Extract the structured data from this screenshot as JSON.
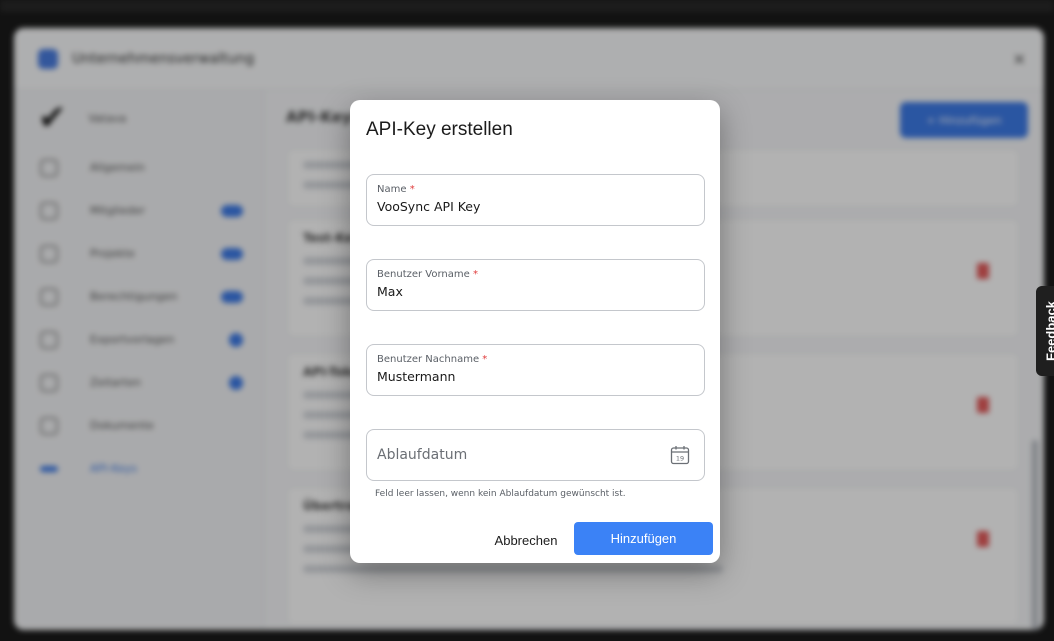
{
  "background": {
    "app_title": "Unternehmensverwaltung",
    "sidebar_header": "Vatava",
    "sidebar_items": [
      {
        "label": "Allgemein",
        "indicator": "none"
      },
      {
        "label": "Mitglieder",
        "indicator": "badge"
      },
      {
        "label": "Projekte",
        "indicator": "badge"
      },
      {
        "label": "Berechtigungen",
        "indicator": "badge"
      },
      {
        "label": "Exportvorlagen",
        "indicator": "dot"
      },
      {
        "label": "Zeitarten",
        "indicator": "dot"
      },
      {
        "label": "Dokumente",
        "indicator": "none"
      },
      {
        "label": "API-Keys",
        "indicator": "active"
      }
    ],
    "content_title": "API-Keys",
    "add_button_label": "+ Hinzufügen",
    "cards": [
      {
        "title": ""
      },
      {
        "title": "Test-Key"
      },
      {
        "title": "API-Token"
      },
      {
        "title": "Übertragung"
      }
    ]
  },
  "feedback_tab": {
    "label": "Feedback"
  },
  "dialog": {
    "title": "API-Key erstellen",
    "fields": {
      "name": {
        "label": "Name",
        "required_mark": "*",
        "value": "VooSync API Key"
      },
      "first_name": {
        "label": "Benutzer Vorname",
        "required_mark": "*",
        "value": "Max"
      },
      "last_name": {
        "label": "Benutzer Nachname",
        "required_mark": "*",
        "value": "Mustermann"
      },
      "expiry": {
        "placeholder": "Ablaufdatum",
        "calendar_day": "19",
        "icon": "calendar-icon"
      }
    },
    "hint": "Feld leer lassen, wenn kein Ablaufdatum gewünscht ist.",
    "cancel_label": "Abbrechen",
    "submit_label": "Hinzufügen",
    "accent_color": "#3b82f6",
    "required_color": "#e03b3b"
  }
}
